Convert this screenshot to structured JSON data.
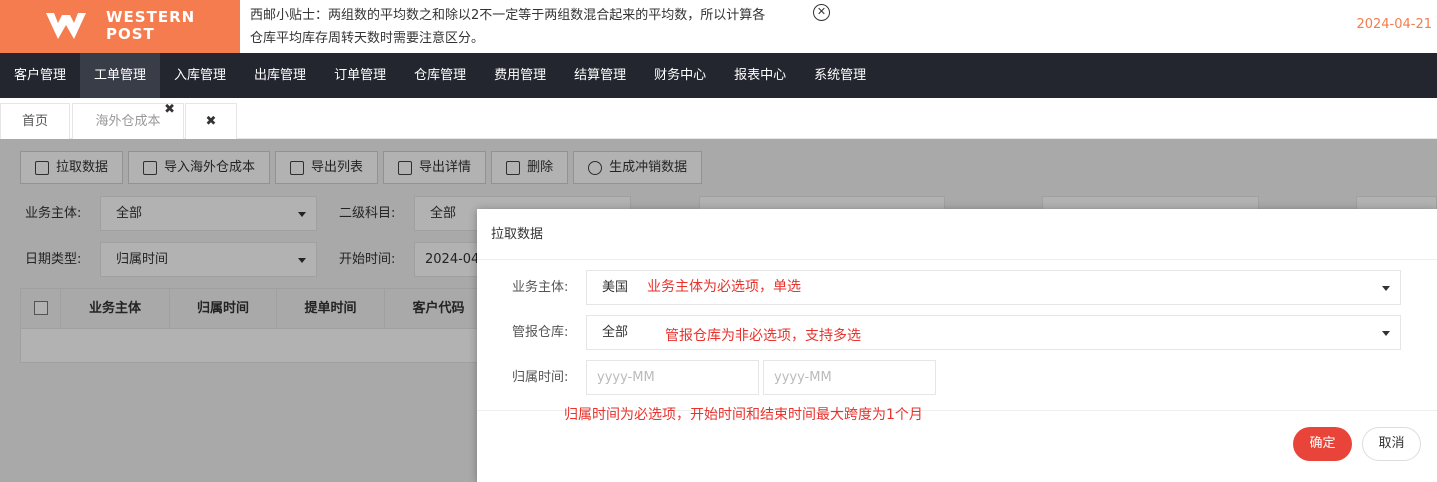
{
  "brand": {
    "line1": "WESTERN",
    "line2": "POST"
  },
  "tip": {
    "line1": "西邮小贴士：两组数的平均数之和除以2不一定等于两组数混合起来的平均数，所以计算各",
    "line2": "仓库平均库存周转天数时需要注意区分。",
    "close_glyph": "✕"
  },
  "date": "2024-04-21",
  "nav": [
    "客户管理",
    "工单管理",
    "入库管理",
    "出库管理",
    "订单管理",
    "仓库管理",
    "费用管理",
    "结算管理",
    "财务中心",
    "报表中心",
    "系统管理"
  ],
  "tabs": {
    "home": "首页",
    "current": "海外仓成本",
    "close_glyph": "✖"
  },
  "toolbar": [
    "拉取数据",
    "导入海外仓成本",
    "导出列表",
    "导出详情",
    "删除",
    "生成冲销数据"
  ],
  "filters": {
    "entity_label": "业务主体:",
    "entity_value": "全部",
    "subject_label": "二级科目:",
    "subject_value": "全部",
    "datetype_label": "日期类型:",
    "datetype_value": "归属时间",
    "start_label": "开始时间:",
    "start_value": "2024-04"
  },
  "grid_headers": [
    "业务主体",
    "归属时间",
    "提单时间",
    "客户代码"
  ],
  "modal": {
    "title": "拉取数据",
    "entity_label": "业务主体:",
    "entity_value": "美国",
    "entity_note": "业务主体为必选项，单选",
    "warehouse_label": "管报仓库:",
    "warehouse_value": "全部",
    "warehouse_note": "管报仓库为非必选项，支持多选",
    "period_label": "归属时间:",
    "period_start_placeholder": "yyyy-MM",
    "period_end_placeholder": "yyyy-MM",
    "period_note": "归属时间为必选项，开始时间和结束时间最大跨度为1个月",
    "ok": "确定",
    "cancel": "取消"
  },
  "colors": {
    "brand": "#f47c4e",
    "nav_bg": "#23262e",
    "primary_button": "#e8443a",
    "note": "#e8322c"
  }
}
